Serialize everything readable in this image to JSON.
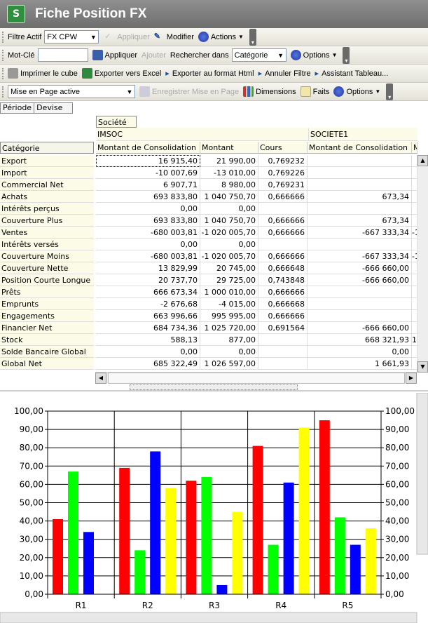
{
  "app": {
    "title": "Fiche Position FX",
    "logo": "S"
  },
  "toolbar1": {
    "filter_label": "Filtre Actif",
    "filter_value": "FX CPW",
    "apply": "Appliquer",
    "modify": "Modifier",
    "actions": "Actions"
  },
  "toolbar2": {
    "keyword_label": "Mot-Clé",
    "keyword_value": "",
    "apply": "Appliquer",
    "add": "Ajouter",
    "search_in": "Rechercher dans",
    "search_value": "Catégorie",
    "options": "Options"
  },
  "toolbar3": {
    "print": "Imprimer le cube",
    "excel": "Exporter vers Excel",
    "html": "Exporter au format Html",
    "cancel": "Annuler Filtre",
    "wizard": "Assistant Tableau..."
  },
  "toolbar4": {
    "layout_label": "Mise en Page active",
    "layout_value": "",
    "save": "Enregistrer Mise en Page",
    "dimensions": "Dimensions",
    "facts": "Faits",
    "options": "Options"
  },
  "tabs": [
    "Période",
    "Devise"
  ],
  "grid": {
    "col_dim": "Société",
    "row_dim": "Catégorie",
    "companies": [
      "IMSOC",
      "SOCIETE1"
    ],
    "columns": [
      "Montant de Consolidation",
      "Montant",
      "Cours",
      "Montant de Consolidation",
      "M"
    ],
    "rows": [
      {
        "label": "Export",
        "values": [
          "16 915,40",
          "21 990,00",
          "0,769232",
          "",
          ""
        ]
      },
      {
        "label": "Import",
        "values": [
          "-10 007,69",
          "-13 010,00",
          "0,769226",
          "",
          ""
        ]
      },
      {
        "label": "Commercial Net",
        "values": [
          "6 907,71",
          "8 980,00",
          "0,769231",
          "",
          ""
        ]
      },
      {
        "label": "Achats",
        "values": [
          "693 833,80",
          "1 040 750,70",
          "0,666666",
          "673,34",
          ""
        ]
      },
      {
        "label": "Intérêts perçus",
        "values": [
          "0,00",
          "0,00",
          "",
          "",
          ""
        ]
      },
      {
        "label": "Couverture Plus",
        "values": [
          "693 833,80",
          "1 040 750,70",
          "0,666666",
          "673,34",
          ""
        ]
      },
      {
        "label": "Ventes",
        "values": [
          "-680 003,81",
          "-1 020 005,70",
          "0,666666",
          "-667 333,34",
          "-1"
        ]
      },
      {
        "label": "Intérêts versés",
        "values": [
          "0,00",
          "0,00",
          "",
          "",
          ""
        ]
      },
      {
        "label": "Couverture Moins",
        "values": [
          "-680 003,81",
          "-1 020 005,70",
          "0,666666",
          "-667 333,34",
          "-1"
        ]
      },
      {
        "label": "Couverture Nette",
        "values": [
          "13 829,99",
          "20 745,00",
          "0,666648",
          "-666 660,00",
          ""
        ]
      },
      {
        "label": "Position Courte Longue",
        "values": [
          "20 737,70",
          "29 725,00",
          "0,743848",
          "-666 660,00",
          ""
        ]
      },
      {
        "label": "Prêts",
        "values": [
          "666 673,34",
          "1 000 010,00",
          "0,666666",
          "",
          ""
        ]
      },
      {
        "label": "Emprunts",
        "values": [
          "-2 676,68",
          "-4 015,00",
          "0,666668",
          "",
          ""
        ]
      },
      {
        "label": "Engagements",
        "values": [
          "663 996,66",
          "995 995,00",
          "0,666666",
          "",
          ""
        ]
      },
      {
        "label": "Financier Net",
        "values": [
          "684 734,36",
          "1 025 720,00",
          "0,691564",
          "-666 660,00",
          ""
        ]
      },
      {
        "label": "Stock",
        "values": [
          "588,13",
          "877,00",
          "",
          "668 321,93",
          "1"
        ]
      },
      {
        "label": "Solde Bancaire Global",
        "values": [
          "0,00",
          "0,00",
          "",
          "0,00",
          ""
        ]
      },
      {
        "label": "Global Net",
        "values": [
          "685 322,49",
          "1 026 597,00",
          "",
          "1 661,93",
          ""
        ]
      }
    ]
  },
  "chart_data": {
    "type": "bar",
    "categories": [
      "R1",
      "R2",
      "R3",
      "R4",
      "R5"
    ],
    "series": [
      {
        "color": "#ff0000",
        "values": [
          41,
          69,
          62,
          81,
          95
        ]
      },
      {
        "color": "#00ff00",
        "values": [
          67,
          24,
          64,
          27,
          42
        ]
      },
      {
        "color": "#0000ff",
        "values": [
          34,
          78,
          5,
          61,
          27
        ]
      },
      {
        "color": "#ffff00",
        "values": [
          0,
          58,
          45,
          91,
          36
        ]
      }
    ],
    "ylim": [
      0,
      100
    ],
    "yticks": [
      "0,00",
      "10,00",
      "20,00",
      "30,00",
      "40,00",
      "50,00",
      "60,00",
      "70,00",
      "80,00",
      "90,00",
      "100,00"
    ],
    "grid": true
  }
}
